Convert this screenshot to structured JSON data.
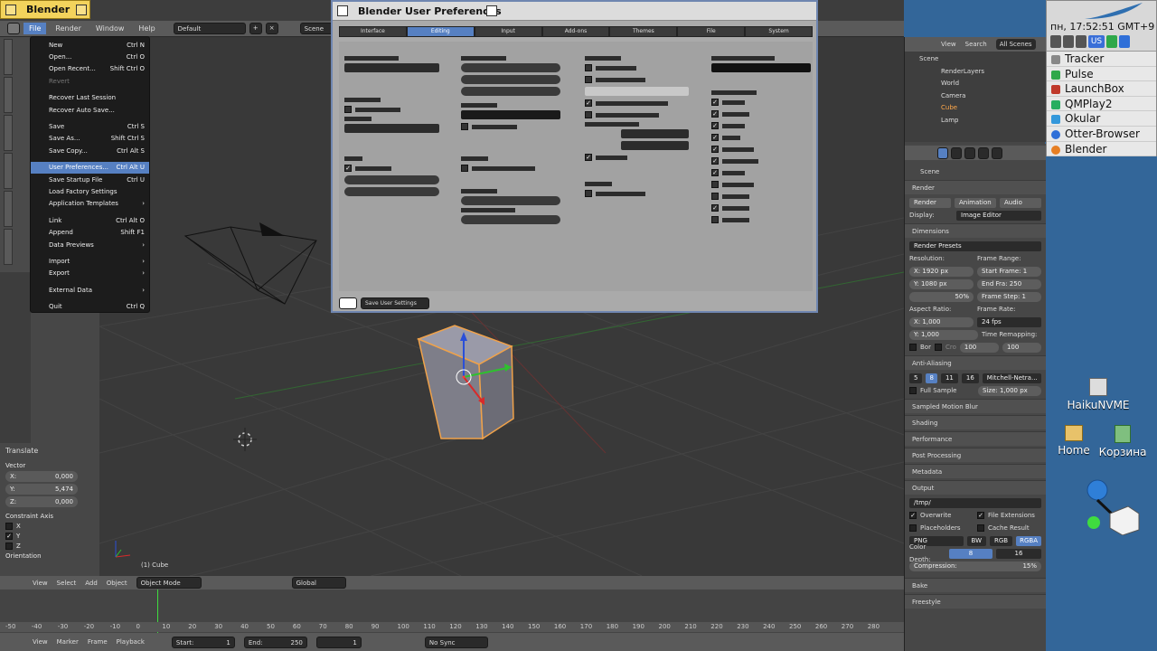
{
  "app": {
    "title": "Blender"
  },
  "topbar": {
    "menus": [
      "File",
      "Render",
      "Window",
      "Help"
    ],
    "layout": "Default",
    "scene": "Scene"
  },
  "file_menu": {
    "items": [
      {
        "label": "New",
        "shortcut": "Ctrl N",
        "state": ""
      },
      {
        "label": "Open...",
        "shortcut": "Ctrl O",
        "state": ""
      },
      {
        "label": "Open Recent...",
        "shortcut": "Shift Ctrl O",
        "state": ""
      },
      {
        "label": "Revert",
        "shortcut": "",
        "state": "dis"
      },
      {
        "label": "Recover Last Session",
        "shortcut": "",
        "state": ""
      },
      {
        "label": "Recover Auto Save...",
        "shortcut": "",
        "state": ""
      },
      {
        "label": "Save",
        "shortcut": "Ctrl S",
        "state": ""
      },
      {
        "label": "Save As...",
        "shortcut": "Shift Ctrl S",
        "state": ""
      },
      {
        "label": "Save Copy...",
        "shortcut": "Ctrl Alt S",
        "state": ""
      },
      {
        "label": "User Preferences...",
        "shortcut": "Ctrl Alt U",
        "state": "hl"
      },
      {
        "label": "Save Startup File",
        "shortcut": "Ctrl U",
        "state": ""
      },
      {
        "label": "Load Factory Settings",
        "shortcut": "",
        "state": ""
      },
      {
        "label": "Application Templates",
        "shortcut": "›",
        "state": ""
      },
      {
        "label": "Link",
        "shortcut": "Ctrl Alt O",
        "state": ""
      },
      {
        "label": "Append",
        "shortcut": "Shift F1",
        "state": ""
      },
      {
        "label": "Data Previews",
        "shortcut": "›",
        "state": ""
      },
      {
        "label": "Import",
        "shortcut": "›",
        "state": ""
      },
      {
        "label": "Export",
        "shortcut": "›",
        "state": ""
      },
      {
        "label": "External Data",
        "shortcut": "›",
        "state": ""
      },
      {
        "label": "Quit",
        "shortcut": "Ctrl Q",
        "state": ""
      }
    ]
  },
  "prefs": {
    "title": "Blender User Preferences",
    "tabs": [
      "Interface",
      "Editing",
      "Input",
      "Add-ons",
      "Themes",
      "File",
      "System"
    ],
    "active_tab": "Editing",
    "save_button": "Save User Settings"
  },
  "viewport": {
    "object_label": "(1) Cube",
    "header": [
      "View",
      "Select",
      "Add",
      "Object"
    ],
    "mode": "Object Mode",
    "orientation": "Global"
  },
  "operator_panel": {
    "title": "Translate",
    "vector_label": "Vector",
    "x": "X:",
    "x_val": "0,000",
    "y": "Y:",
    "y_val": "5,474",
    "z": "Z:",
    "z_val": "0,000",
    "constraint_label": "Constraint Axis",
    "axes": [
      "X",
      "Y",
      "Z"
    ],
    "orientation_label": "Orientation"
  },
  "timeline": {
    "ruler": [
      "-50",
      "-40",
      "-30",
      "-20",
      "-10",
      "0",
      "10",
      "20",
      "30",
      "40",
      "50",
      "60",
      "70",
      "80",
      "90",
      "100",
      "110",
      "120",
      "130",
      "140",
      "150",
      "160",
      "170",
      "180",
      "190",
      "200",
      "210",
      "220",
      "230",
      "240",
      "250",
      "260",
      "270",
      "280"
    ],
    "header": [
      "View",
      "Marker",
      "Frame",
      "Playback"
    ],
    "start": "Start:",
    "start_val": "1",
    "end": "End:",
    "end_val": "250",
    "current": "1",
    "sync": "No Sync"
  },
  "outliner": {
    "header": [
      "View",
      "Search"
    ],
    "scenes": "All Scenes",
    "items": [
      "Scene",
      "RenderLayers",
      "World",
      "Camera",
      "Cube",
      "Lamp"
    ]
  },
  "properties": {
    "context": "Scene",
    "render_title": "Render",
    "buttons": [
      "Render",
      "Animation",
      "Audio"
    ],
    "display": "Display:",
    "display_val": "Image Editor",
    "dimensions": "Dimensions",
    "presets": "Render Presets",
    "resolution": "Resolution:",
    "res_x": "X:",
    "res_x_val": "1920 px",
    "res_y": "Y:",
    "res_y_val": "1080 px",
    "res_pct": "50%",
    "frame_range": "Frame Range:",
    "start_frame": "Start Frame: 1",
    "end_frame": "End Fra:   250",
    "frame_step": "Frame Step: 1",
    "aspect": "Aspect Ratio:",
    "asp_x": "X:",
    "asp_x_val": "1,000",
    "asp_y": "Y:",
    "asp_y_val": "1,000",
    "frame_rate": "Frame Rate:",
    "fps": "24 fps",
    "remap": "Time Remapping:",
    "remap_a": "100",
    "remap_b": "100",
    "bor": "Bor",
    "cro": "Cro",
    "aa": "Anti-Aliasing",
    "aa_samples": [
      "5",
      "8",
      "11",
      "16"
    ],
    "aa_filter": "Mitchell-Netra...",
    "full_sample": "Full Sample",
    "aa_size": "Size: 1,000 px",
    "sections": [
      "Sampled Motion Blur",
      "Shading",
      "Performance",
      "Post Processing",
      "Metadata"
    ],
    "output": "Output",
    "out_path": "/tmp/",
    "overwrite": "Overwrite",
    "file_ext": "File Extensions",
    "placeholders": "Placeholders",
    "cache": "Cache Result",
    "format": "PNG",
    "color_modes": [
      "BW",
      "RGB",
      "RGBA"
    ],
    "color_depth": "Color Depth:",
    "depth_a": "8",
    "depth_b": "16",
    "compression": "Compression:",
    "compression_val": "15%",
    "bake": "Bake",
    "freestyle": "Freestyle"
  },
  "deskbar": {
    "clock": "пн, 17:52:51 GMT+9",
    "lang": "US",
    "apps": [
      "Tracker",
      "Pulse",
      "LaunchBox",
      "QMPlay2",
      "Okular",
      "Otter-Browser",
      "Blender"
    ]
  },
  "desktop_icons": [
    "HaikuNVME",
    "Home",
    "Корзина"
  ],
  "colors": {
    "accent": "#5680c2",
    "desktop": "#336699",
    "haiku_tab": "#f3d35c"
  }
}
